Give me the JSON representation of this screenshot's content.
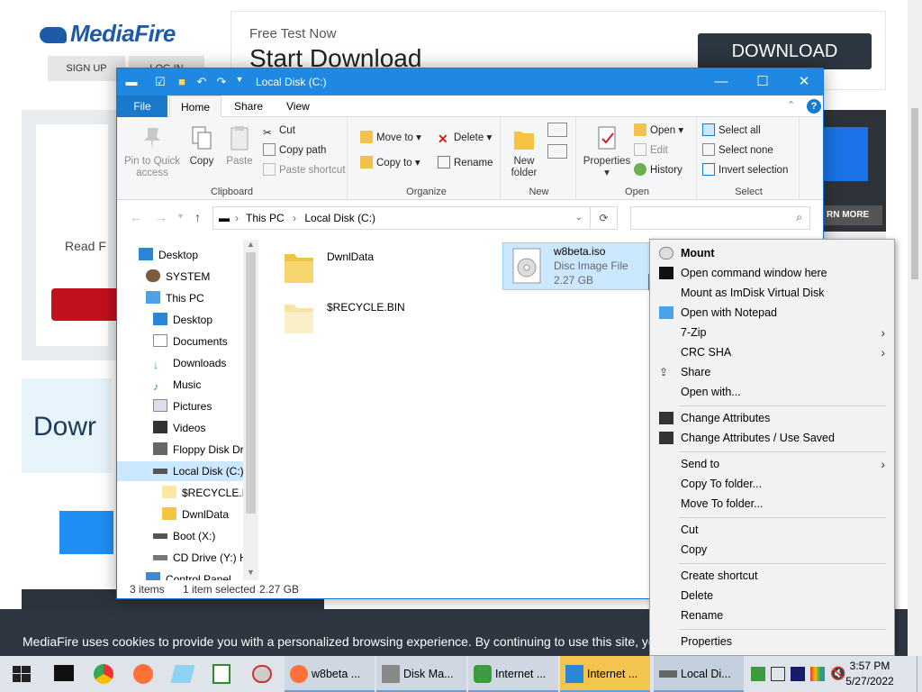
{
  "browser_page": {
    "logo": "MediaFire",
    "signup_label": "SIGN UP",
    "login_label": "LOG IN",
    "ad_free_test": "Free Test Now",
    "ad_start_download": "Start Download",
    "ad_download_button": "DOWNLOAD",
    "read_partial": "Read F",
    "download_partial": "Dowr",
    "learn_more": "RN MORE",
    "cookie_text": "MediaFire uses cookies to provide you with a personalized browsing experience. By continuing to use this site, you agre"
  },
  "explorer": {
    "title": "Local Disk (C:)",
    "tabs": [
      "File",
      "Home",
      "Share",
      "View"
    ],
    "ribbon": {
      "clipboard": {
        "label": "Clipboard",
        "pin": "Pin to Quick access",
        "copy": "Copy",
        "paste": "Paste",
        "cut": "Cut",
        "copy_path": "Copy path",
        "paste_shortcut": "Paste shortcut"
      },
      "organize": {
        "label": "Organize",
        "move_to": "Move to",
        "copy_to": "Copy to",
        "delete": "Delete",
        "rename": "Rename"
      },
      "new": {
        "label": "New",
        "new_folder": "New folder"
      },
      "open": {
        "label": "Open",
        "properties": "Properties",
        "open": "Open",
        "edit": "Edit",
        "history": "History"
      },
      "select": {
        "label": "Select",
        "select_all": "Select all",
        "select_none": "Select none",
        "invert": "Invert selection"
      }
    },
    "breadcrumb": [
      "This PC",
      "Local Disk (C:)"
    ],
    "nav_items": [
      "Desktop",
      "SYSTEM",
      "This PC",
      "Desktop",
      "Documents",
      "Downloads",
      "Music",
      "Pictures",
      "Videos",
      "Floppy Disk Dri",
      "Local Disk (C:)",
      "$RECYCLE.BIN",
      "DwnlData",
      "Boot (X:)",
      "CD Drive (Y:) H",
      "Control Panel"
    ],
    "files": [
      {
        "name": "DwnlData"
      },
      {
        "name": "$RECYCLE.BIN"
      },
      {
        "name": "w8beta.iso",
        "type": "Disc Image File",
        "size": "2.27 GB"
      }
    ],
    "status": {
      "items": "3 items",
      "selected": "1 item selected",
      "size": "2.27 GB"
    }
  },
  "context_menu": {
    "items": [
      "Mount",
      "Open command window here",
      "Mount as ImDisk Virtual Disk",
      "Open with Notepad",
      "7-Zip",
      "CRC SHA",
      "Share",
      "Open with...",
      "Change Attributes",
      "Change Attributes / Use Saved",
      "Send to",
      "Copy To folder...",
      "Move To folder...",
      "Cut",
      "Copy",
      "Create shortcut",
      "Delete",
      "Rename",
      "Properties"
    ]
  },
  "taskbar": {
    "apps": [
      "w8beta ...",
      "Disk Ma...",
      "Internet ...",
      "Internet ...",
      "Local Di..."
    ],
    "time": "3:57 PM",
    "date": "5/27/2022"
  },
  "colors": {
    "title_blue": "#1f88e0",
    "selection": "#cce8ff",
    "mediafire_blue": "#1d5aa8",
    "cookie_bar": "#2d3641"
  }
}
